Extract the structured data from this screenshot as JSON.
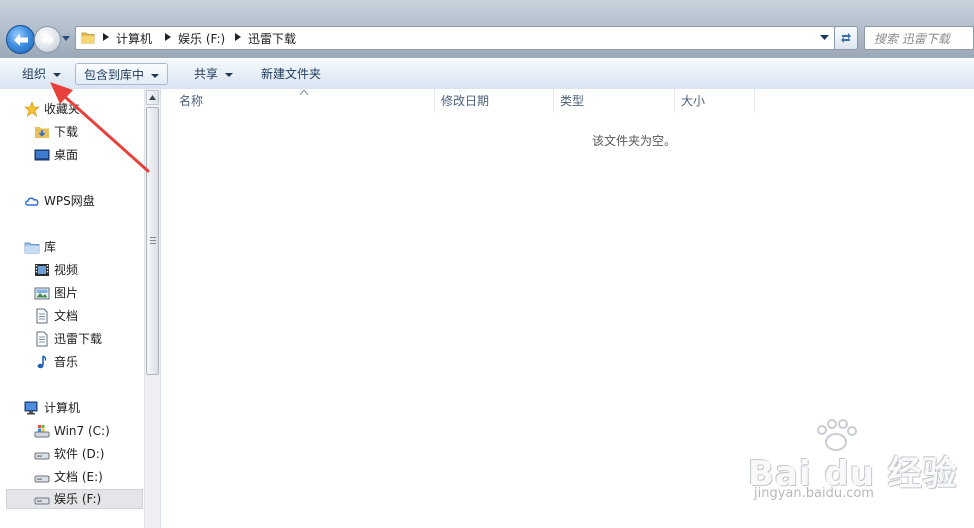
{
  "address_bar": {
    "crumbs": [
      "计算机",
      "娱乐 (F:)",
      "迅雷下载"
    ],
    "search_placeholder": "搜索 迅雷下载"
  },
  "toolbar": {
    "organize": "组织",
    "include_in_library": "包含到库中",
    "share": "共享",
    "new_folder": "新建文件夹"
  },
  "nav": {
    "favorites": {
      "label": "收藏夹",
      "items": [
        "下载",
        "桌面"
      ]
    },
    "wps": "WPS网盘",
    "libraries": {
      "label": "库",
      "items": [
        "视频",
        "图片",
        "文档",
        "迅雷下载",
        "音乐"
      ]
    },
    "computer": {
      "label": "计算机",
      "items": [
        "Win7 (C:)",
        "软件 (D:)",
        "文档 (E:)",
        "娱乐 (F:)"
      ],
      "selected": "娱乐 (F:)"
    }
  },
  "columns": [
    "名称",
    "修改日期",
    "类型",
    "大小"
  ],
  "empty_message": "该文件夹为空。",
  "watermark": {
    "main": "Bai du 经验",
    "sub": "jingyan.baidu.com"
  },
  "colors": {
    "annotation_arrow": "#e8403a",
    "selection": "#e3e5e8",
    "toolbar_text": "#1e395b"
  }
}
